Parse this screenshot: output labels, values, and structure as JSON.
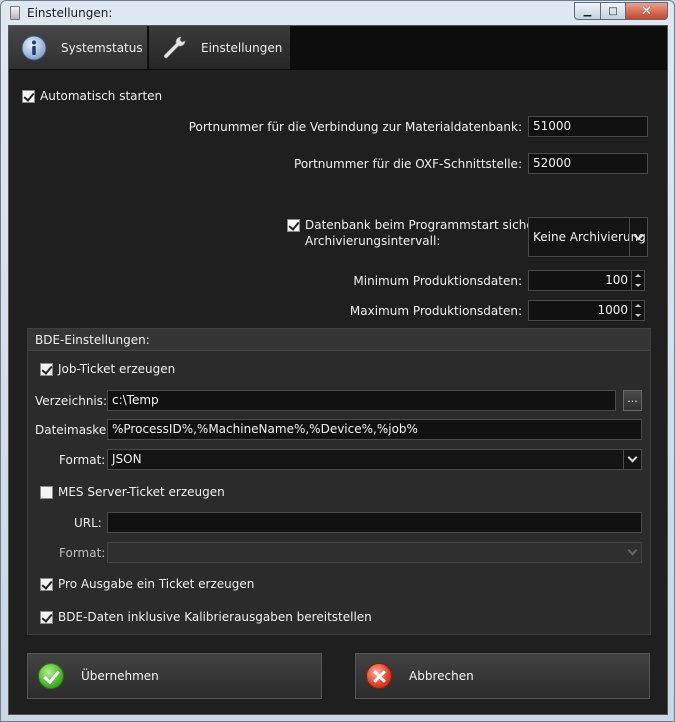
{
  "window": {
    "title": "Einstellungen:"
  },
  "tabs": [
    {
      "label": "Systemstatus",
      "icon": "info-icon",
      "active": true
    },
    {
      "label": "Einstellungen",
      "icon": "wrench-icon",
      "active": false
    }
  ],
  "general": {
    "autostart_label": "Automatisch starten",
    "autostart_checked": true,
    "port_material_label": "Portnummer für die Verbindung zur Materialdatenbank:",
    "port_material_value": "51000",
    "port_oxf_label": "Portnummer für die OXF-Schnittstelle:",
    "port_oxf_value": "52000",
    "backup_label": "Datenbank beim Programmstart sichern.",
    "backup_checked": true,
    "archive_interval_label": "Archivierungsintervall:",
    "archive_interval_value": "Keine Archivierung",
    "min_prod_label": "Minimum Produktionsdaten:",
    "min_prod_value": "100",
    "max_prod_label": "Maximum Produktionsdaten:",
    "max_prod_value": "1000"
  },
  "bde": {
    "group_title": "BDE-Einstellungen:",
    "job_ticket_label": "Job-Ticket erzeugen",
    "job_ticket_checked": true,
    "directory_label": "Verzeichnis:",
    "directory_value": "c:\\Temp",
    "browse_label": "...",
    "filemask_label": "Dateimaske:",
    "filemask_value": "%ProcessID%,%MachineName%,%Device%,%job%",
    "format_label": "Format:",
    "format_value": "JSON",
    "mes_ticket_label": "MES Server-Ticket erzeugen",
    "mes_ticket_checked": false,
    "url_label": "URL:",
    "url_value": "",
    "mes_format_label": "Format:",
    "mes_format_value": "",
    "per_output_label": "Pro Ausgabe ein Ticket erzeugen",
    "per_output_checked": true,
    "calibration_label": "BDE-Daten inklusive Kalibrierausgaben bereitstellen",
    "calibration_checked": true
  },
  "actions": {
    "apply_label": "Übernehmen",
    "cancel_label": "Abbrechen"
  },
  "colors": {
    "background": "#1f1f1f",
    "panel": "#2b2b2b",
    "ok_green": "#4cba2a",
    "cancel_red": "#e0442a"
  }
}
